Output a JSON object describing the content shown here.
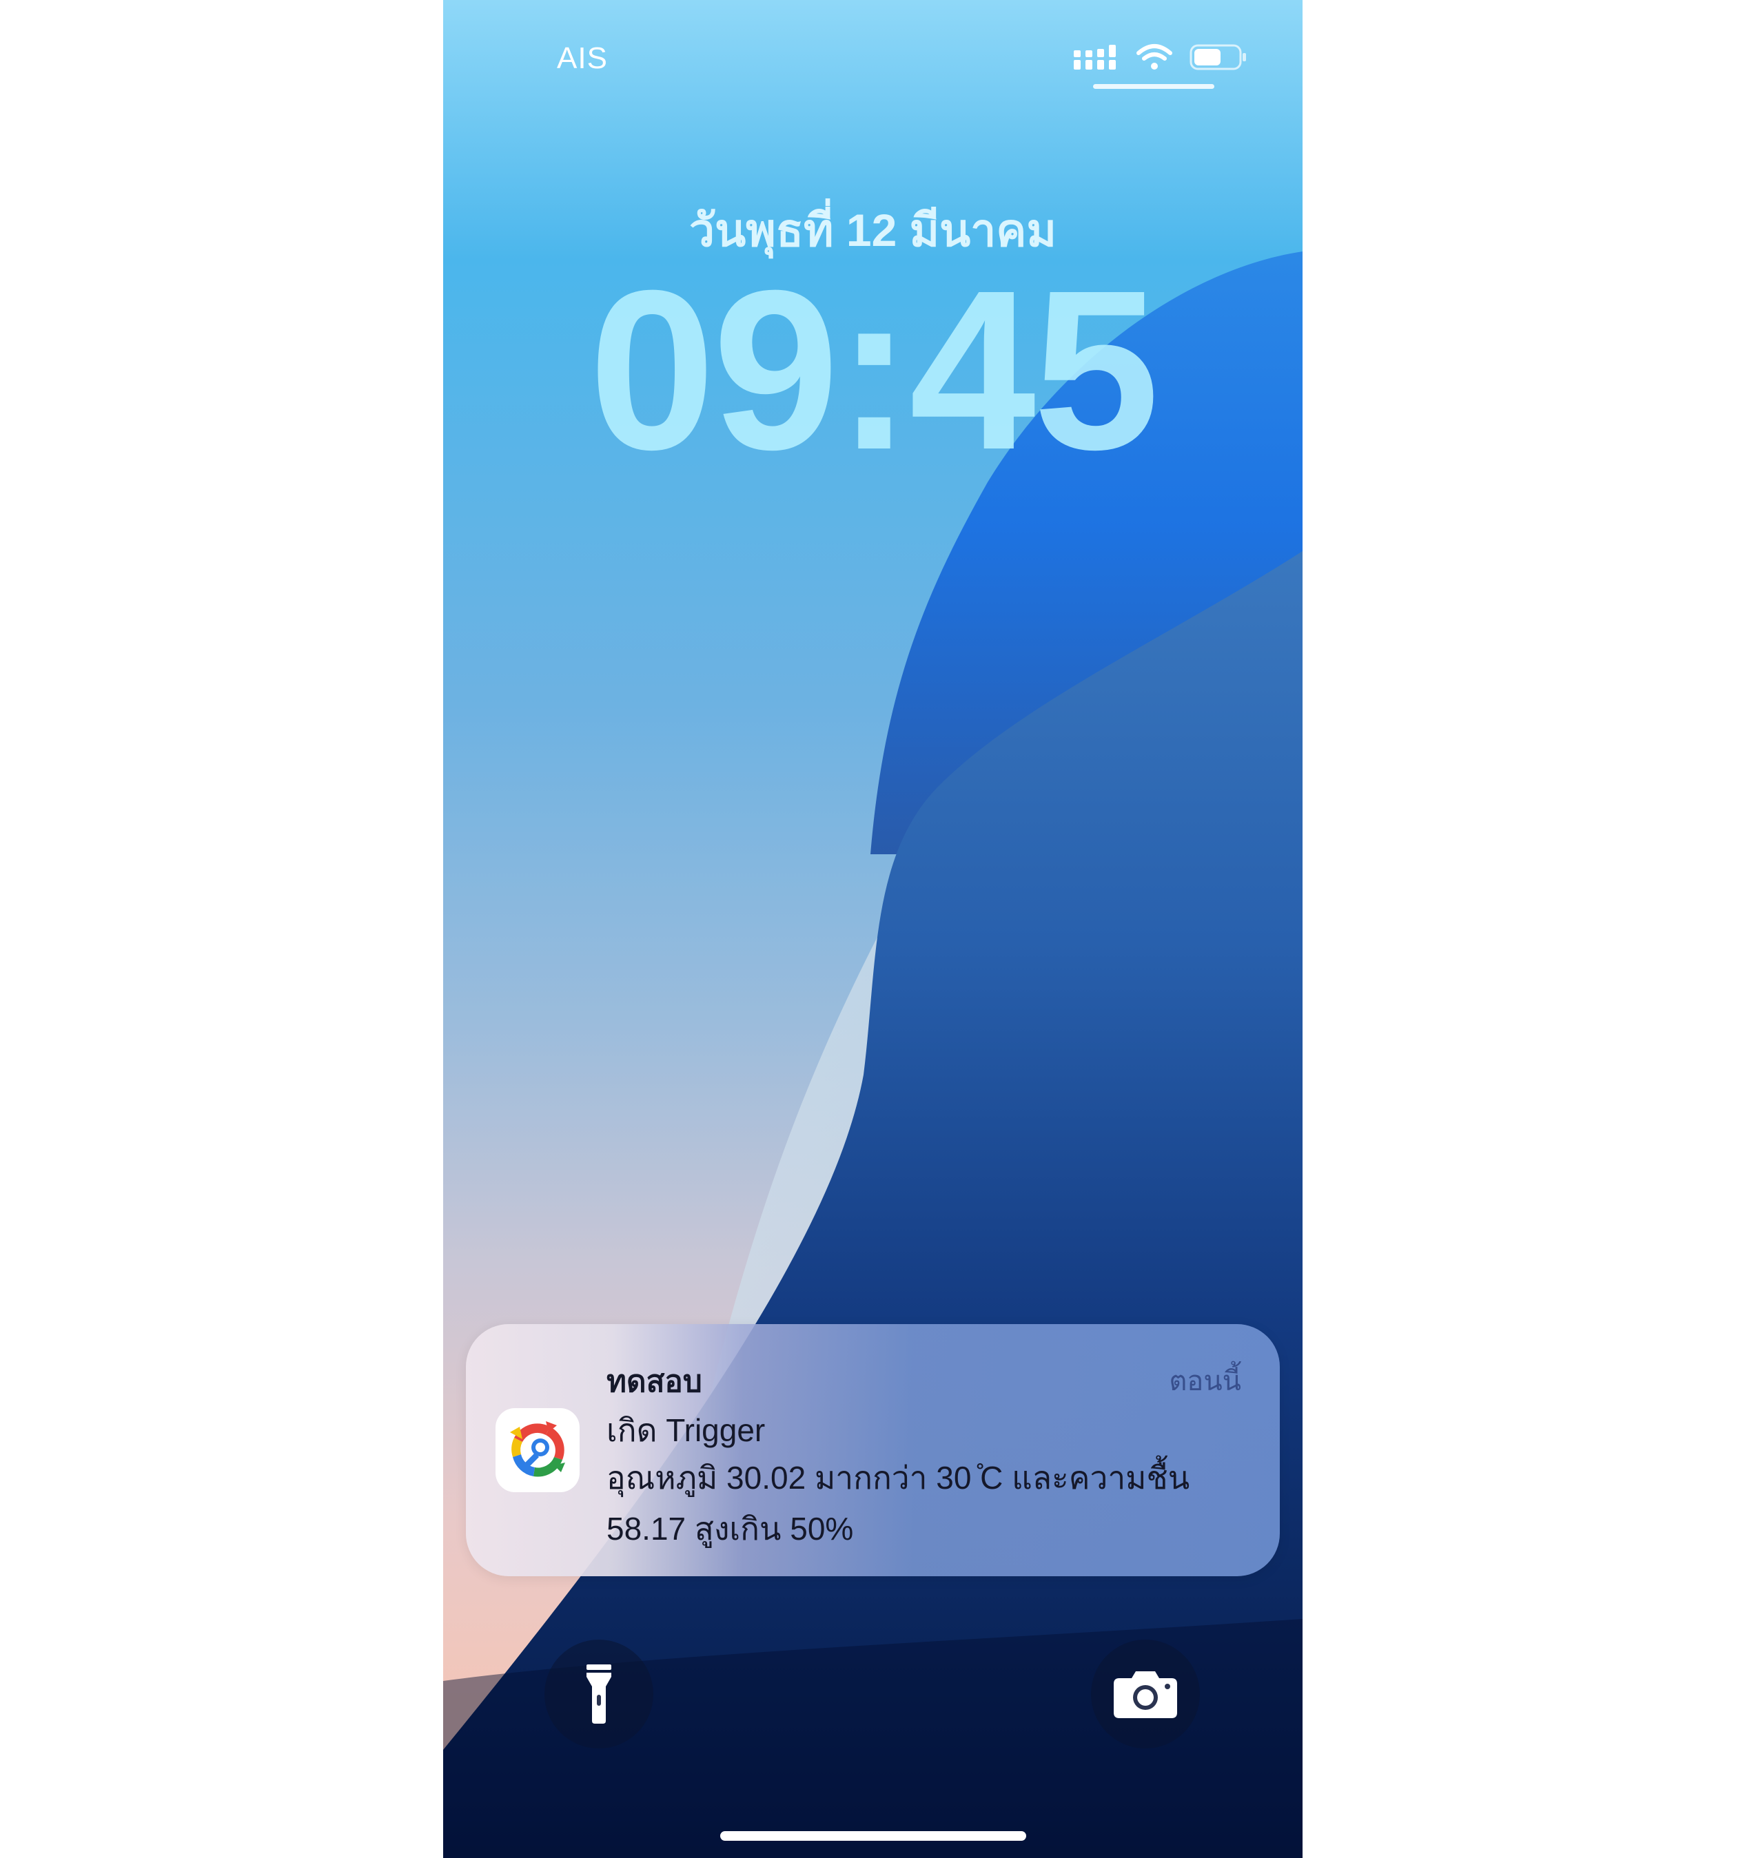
{
  "status_bar": {
    "carrier": "AIS",
    "icons": [
      "cellular-signal-icon",
      "wifi-icon",
      "battery-icon"
    ],
    "battery_level": 0.62
  },
  "lock_screen": {
    "date": "วันพุธที่ 12 มีนาคม",
    "time": "09:45"
  },
  "notification": {
    "app_icon": "automation-app-icon",
    "title": "ทดสอบ",
    "timestamp": "ตอนนี้",
    "subtitle": "เกิด Trigger",
    "body": "อุณหภูมิ 30.02 มากกว่า 30 ̊C และความชื้น 58.17 สูงเกิน 50%"
  },
  "quick_actions": {
    "left": "flashlight-icon",
    "right": "camera-icon"
  },
  "colors": {
    "wave_blue": "#1a6fe0",
    "wave_navy": "#0b2a6a",
    "notification_text": "#15182a"
  }
}
